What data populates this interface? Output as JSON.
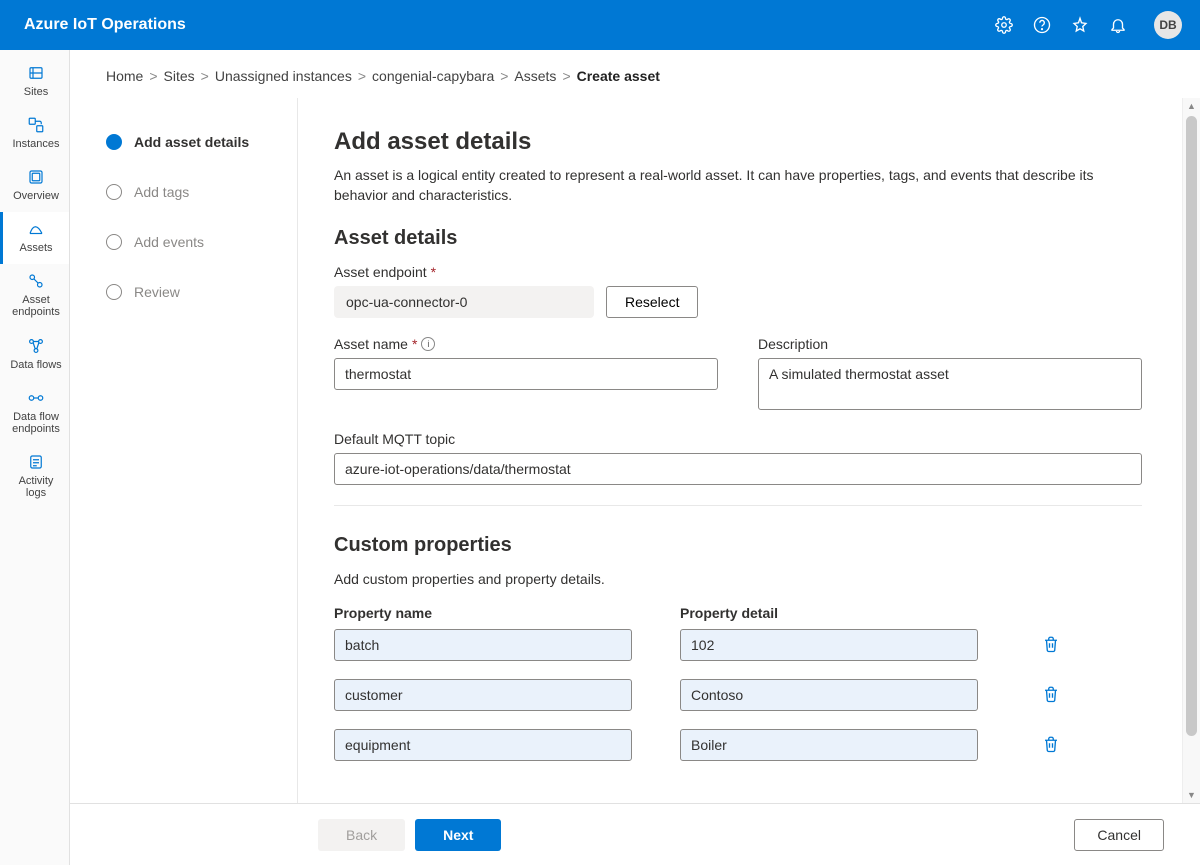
{
  "header": {
    "title": "Azure IoT Operations",
    "avatar_initials": "DB"
  },
  "rail": {
    "items": [
      {
        "label": "Sites"
      },
      {
        "label": "Instances"
      },
      {
        "label": "Overview"
      },
      {
        "label": "Assets"
      },
      {
        "label": "Asset endpoints"
      },
      {
        "label": "Data flows"
      },
      {
        "label": "Data flow endpoints"
      },
      {
        "label": "Activity logs"
      }
    ]
  },
  "breadcrumb": {
    "parts": [
      "Home",
      "Sites",
      "Unassigned instances",
      "congenial-capybara",
      "Assets"
    ],
    "current": "Create asset",
    "sep": ">"
  },
  "wizard": {
    "steps": [
      {
        "label": "Add asset details"
      },
      {
        "label": "Add tags"
      },
      {
        "label": "Add events"
      },
      {
        "label": "Review"
      }
    ]
  },
  "page": {
    "title": "Add asset details",
    "intro": "An asset is a logical entity created to represent a real-world asset. It can have properties, tags, and events that describe its behavior and characteristics.",
    "asset_details_heading": "Asset details",
    "asset_endpoint_label": "Asset endpoint",
    "asset_endpoint_value": "opc-ua-connector-0",
    "reselect_label": "Reselect",
    "asset_name_label": "Asset name",
    "asset_name_value": "thermostat",
    "description_label": "Description",
    "description_value": "A simulated thermostat asset",
    "default_mqtt_label": "Default MQTT topic",
    "default_mqtt_value": "azure-iot-operations/data/thermostat",
    "custom_props_heading": "Custom properties",
    "custom_props_sub": "Add custom properties and property details.",
    "prop_name_header": "Property name",
    "prop_detail_header": "Property detail",
    "properties": [
      {
        "name": "batch",
        "detail": "102"
      },
      {
        "name": "customer",
        "detail": "Contoso"
      },
      {
        "name": "equipment",
        "detail": "Boiler"
      }
    ]
  },
  "footer": {
    "back": "Back",
    "next": "Next",
    "cancel": "Cancel"
  },
  "required_marker": "*"
}
